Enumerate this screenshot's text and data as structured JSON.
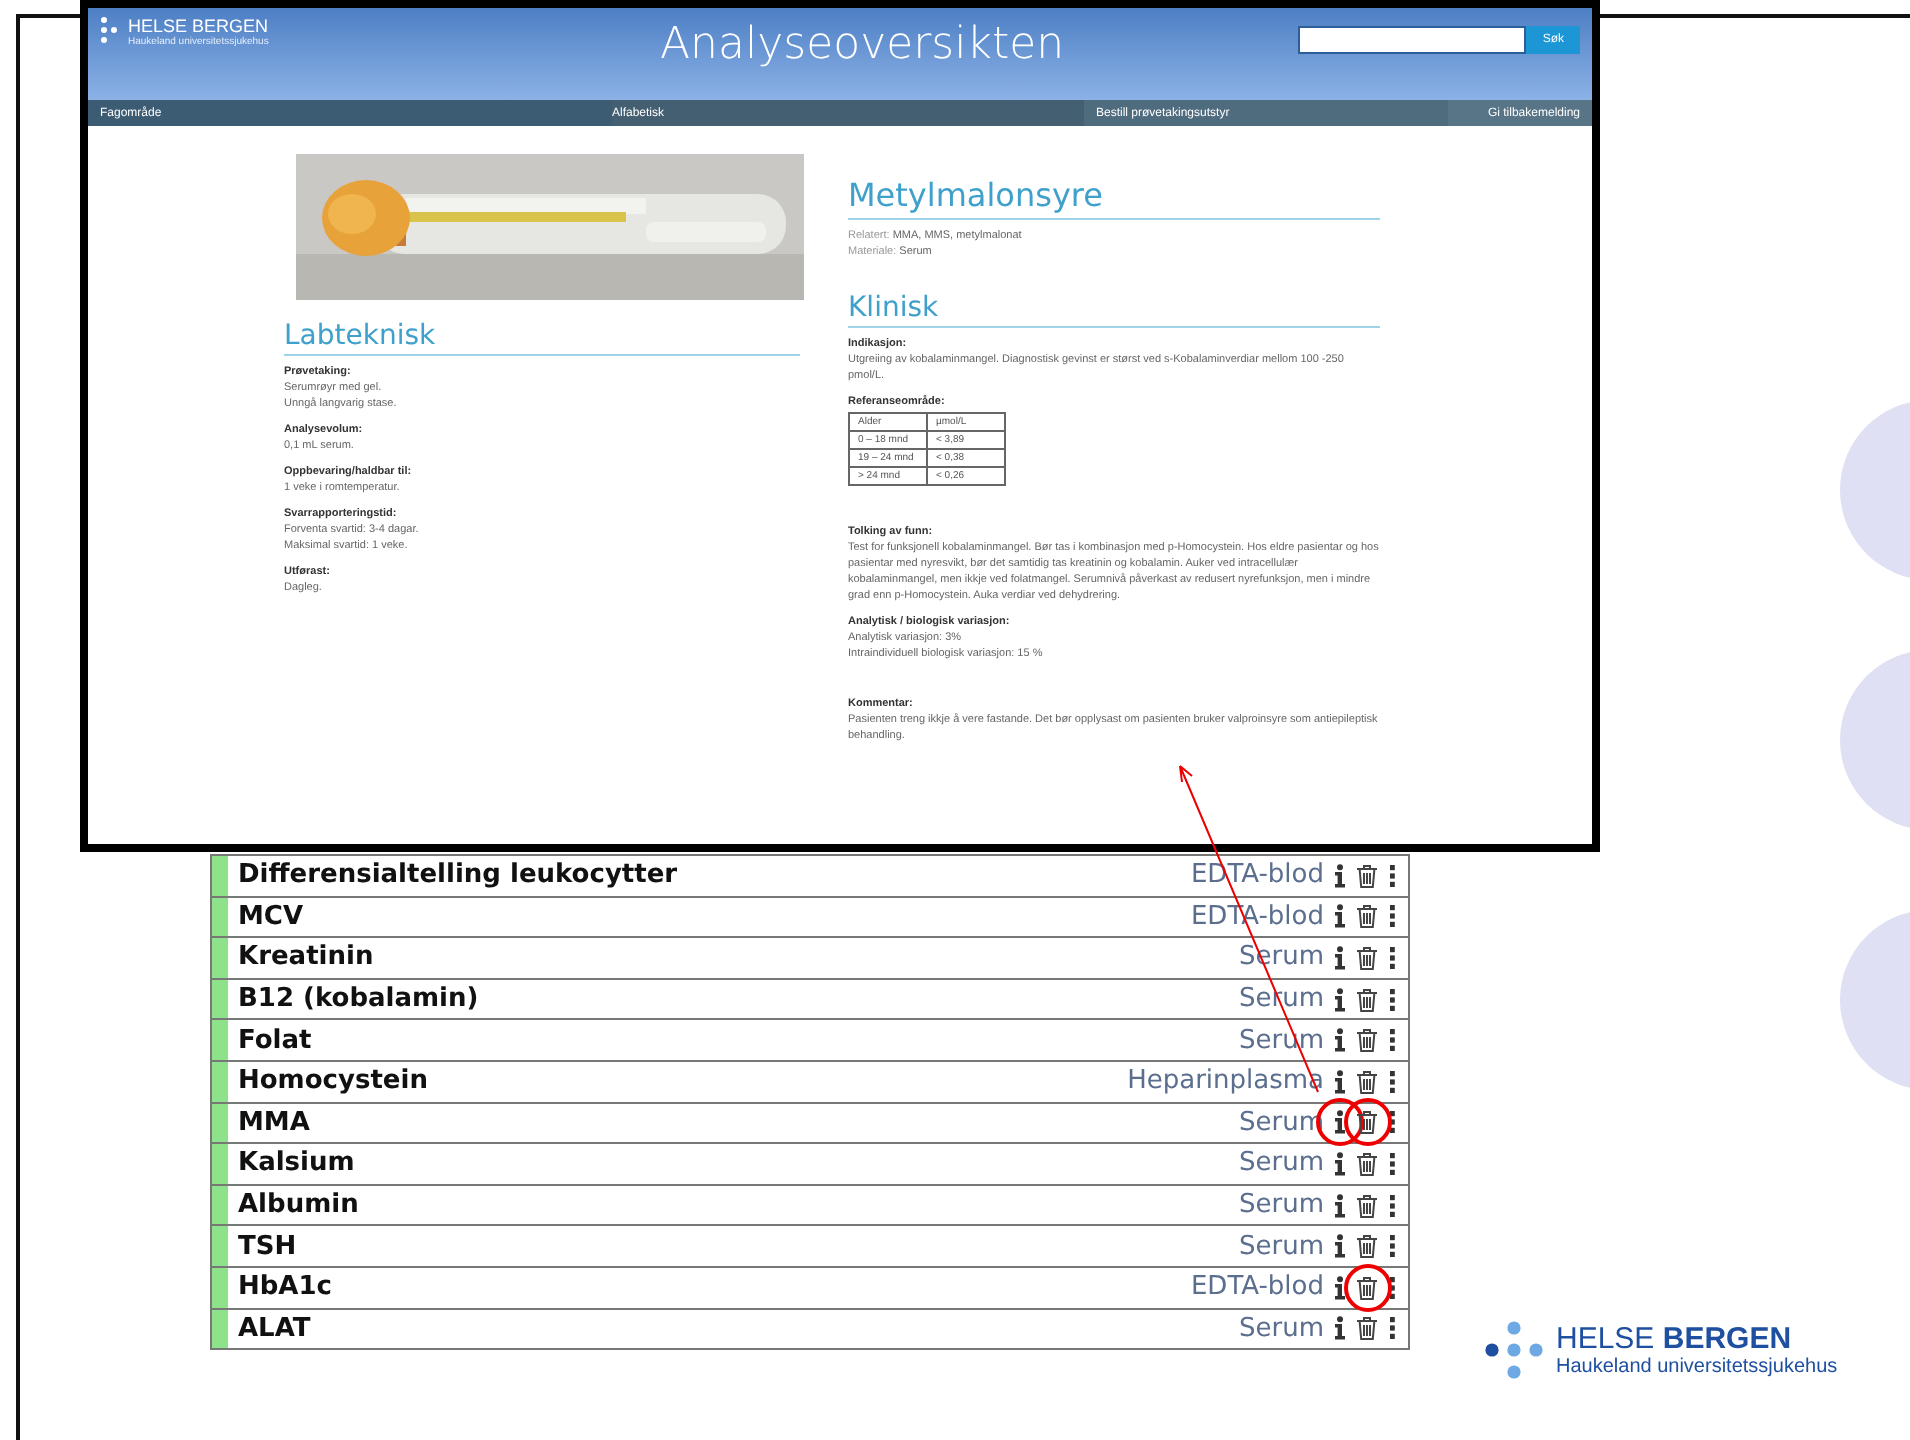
{
  "web_page": {
    "logo": {
      "name": "HELSE BERGEN",
      "subtitle": "Haukeland universitetssjukehus"
    },
    "title": "Analyseoversikten",
    "search": {
      "button": "Søk"
    },
    "nav": [
      {
        "label": "Fagområde"
      },
      {
        "label": "Alfabetisk"
      },
      {
        "label": "Bestill prøvetakingsutstyr"
      },
      {
        "label": "Gi tilbakemelding"
      }
    ],
    "lab": {
      "heading": "Labteknisk",
      "sections": [
        {
          "label": "Prøvetaking:",
          "lines": [
            "Serumrøyr med gel.",
            "Unngå langvarig stase."
          ]
        },
        {
          "label": "Analysevolum:",
          "lines": [
            "0,1 mL serum."
          ]
        },
        {
          "label": "Oppbevaring/haldbar til:",
          "lines": [
            "1 veke i romtemperatur."
          ]
        },
        {
          "label": "Svarrapporteringstid:",
          "lines": [
            "Forventa svartid: 3-4 dagar.",
            "Maksimal svartid: 1 veke."
          ]
        },
        {
          "label": "Utførast:",
          "lines": [
            "Dagleg."
          ]
        }
      ]
    },
    "analysis": {
      "title": "Metylmalonsyre",
      "meta": [
        {
          "label": "Relatert:",
          "value": "MMA, MMS, metylmalonat"
        },
        {
          "label": "Materiale:",
          "value": "Serum"
        }
      ]
    },
    "clinical": {
      "heading": "Klinisk",
      "indication": {
        "label": "Indikasjon:",
        "text": "Utgreiing av kobalaminmangel. Diagnostisk gevinst er størst ved s-Kobalaminverdiar mellom 100 -250 pmol/L."
      },
      "reference": {
        "label": "Referanseområde:",
        "columns": [
          "Alder",
          "µmol/L"
        ],
        "rows": [
          [
            "0 – 18 mnd",
            "< 3,89"
          ],
          [
            "19 – 24 mnd",
            "< 0,38"
          ],
          [
            "> 24 mnd",
            "< 0,26"
          ]
        ]
      },
      "sections": [
        {
          "label": "Tolking av funn:",
          "lines": [
            "Test for funksjonell kobalaminmangel. Bør tas i kombinasjon med p-Homocystein. Hos eldre pasientar og hos pasientar med nyresvikt, bør det samtidig tas kreatinin og kobalamin. Auker ved intracellulær kobalaminmangel, men ikkje ved folatmangel. Serumnivå påverkast av redusert nyrefunksjon, men i mindre grad enn p-Homocystein. Auka verdiar ved dehydrering."
          ]
        },
        {
          "label": "Analytisk / biologisk variasjon:",
          "lines": [
            "Analytisk variasjon: 3%",
            "Intraindividuell biologisk variasjon: 15 %"
          ]
        },
        {
          "label": "Kommentar:",
          "lines": [
            "Pasienten treng ikkje å vere fastande. Det bør opplysast om pasienten bruker valproinsyre som antiepileptisk behandling."
          ]
        }
      ]
    }
  },
  "analyses": [
    {
      "name": "Differensialtelling leukocytter",
      "material": "EDTA-blod",
      "info_marked": false,
      "delete_marked": false
    },
    {
      "name": "MCV",
      "material": "EDTA-blod",
      "info_marked": false,
      "delete_marked": false
    },
    {
      "name": "Kreatinin",
      "material": "Serum",
      "info_marked": false,
      "delete_marked": false
    },
    {
      "name": "B12 (kobalamin)",
      "material": "Serum",
      "info_marked": false,
      "delete_marked": false
    },
    {
      "name": "Folat",
      "material": "Serum",
      "info_marked": false,
      "delete_marked": false
    },
    {
      "name": "Homocystein",
      "material": "Heparinplasma",
      "info_marked": false,
      "delete_marked": false
    },
    {
      "name": "MMA",
      "material": "Serum",
      "info_marked": true,
      "delete_marked": true
    },
    {
      "name": "Kalsium",
      "material": "Serum",
      "info_marked": false,
      "delete_marked": false
    },
    {
      "name": "Albumin",
      "material": "Serum",
      "info_marked": false,
      "delete_marked": false
    },
    {
      "name": "TSH",
      "material": "Serum",
      "info_marked": false,
      "delete_marked": false
    },
    {
      "name": "HbA1c",
      "material": "EDTA-blod",
      "info_marked": false,
      "delete_marked": true
    },
    {
      "name": "ALAT",
      "material": "Serum",
      "info_marked": false,
      "delete_marked": false
    }
  ],
  "footer_logo": {
    "name_light": "HELSE",
    "name_bold": "BERGEN",
    "subtitle": "Haukeland universitetssjukehus"
  }
}
